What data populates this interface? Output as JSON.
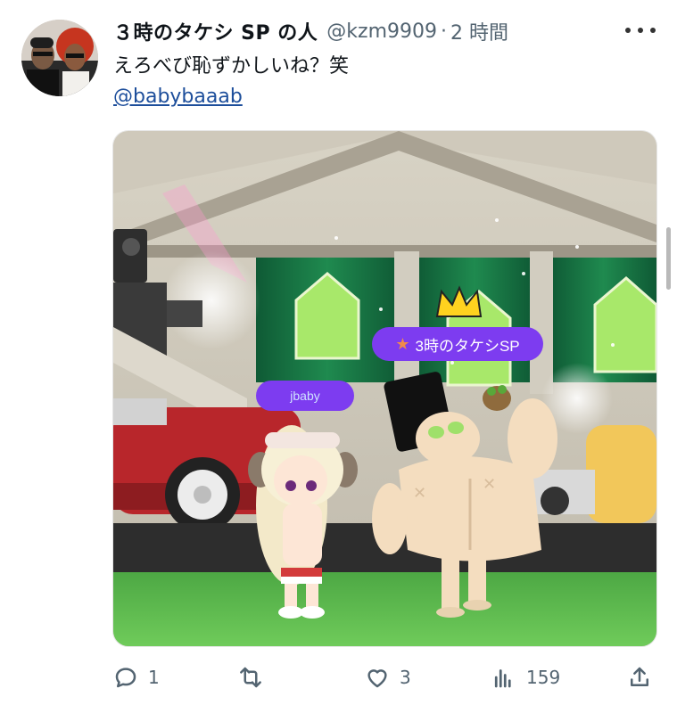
{
  "tweet": {
    "display_name": "３時のタケシ SP の人",
    "handle": "@kzm9909",
    "separator": "·",
    "time": "2 時間",
    "text": "えろべび恥ずかしいね？笑",
    "mention": "@babybaaab"
  },
  "media": {
    "game_tags": {
      "left_tag": "jbaby",
      "right_tag": "3時のタケシSP"
    }
  },
  "actions": {
    "reply_count": "1",
    "retweet_count": "",
    "like_count": "3",
    "views_count": "159"
  },
  "colors": {
    "tag_purple": "#7d3cf0",
    "floor_green": "#5dbb4f",
    "car_red": "#b8262b"
  }
}
